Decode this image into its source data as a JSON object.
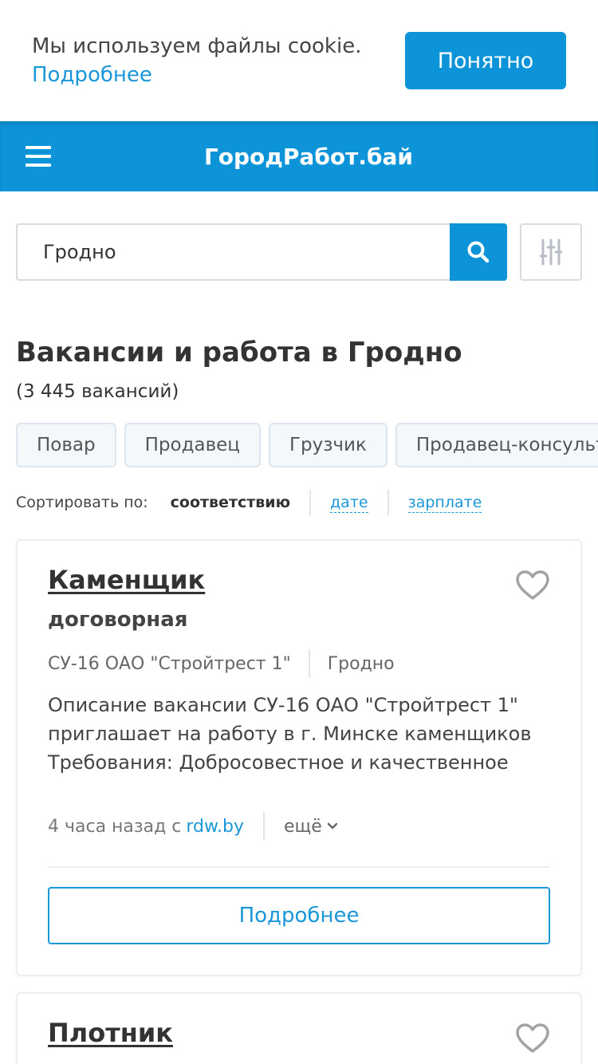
{
  "cookie": {
    "text": "Мы используем файлы cookie.",
    "link": "Подробнее",
    "accept_label": "Понятно"
  },
  "header": {
    "brand": "ГородРабот.бай",
    "menu_icon": "hamburger-menu-icon"
  },
  "search": {
    "value": "Гродно",
    "search_icon": "search-icon",
    "filter_icon": "sliders-filter-icon"
  },
  "page": {
    "title": "Вакансии и работа в Гродно",
    "count": "(3 445 вакансий)"
  },
  "chips": [
    "Повар",
    "Продавец",
    "Грузчик",
    "Продавец-консультант"
  ],
  "sort": {
    "label": "Сортировать по:",
    "active": "соответствию",
    "options": [
      "дате",
      "зарплате"
    ]
  },
  "jobs": [
    {
      "title": "Каменщик",
      "salary": "договорная",
      "company": "СУ-16 ОАО \"Стройтрест 1\"",
      "city": "Гродно",
      "description": "Описание вакансии СУ-16 ОАО \"Стройтрест 1\" приглашает на работу в г. Минске каменщиков Требования: Добросовестное и качественное",
      "time": "4 часа назад с",
      "source": "rdw.by",
      "more": "ещё",
      "details_label": "Подробнее"
    },
    {
      "title": "Плотник"
    }
  ],
  "colors": {
    "accent": "#0d94d8",
    "link": "#1a97d8",
    "text": "#333333"
  }
}
